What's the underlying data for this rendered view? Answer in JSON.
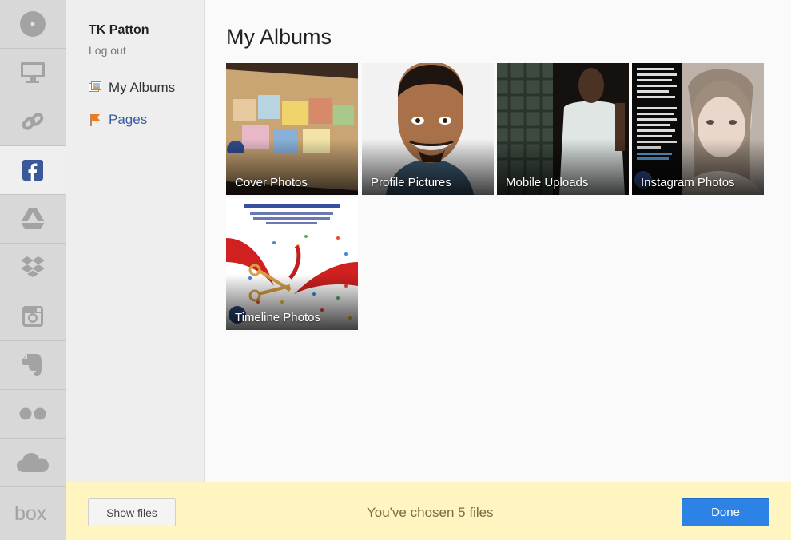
{
  "sidebar": {
    "user_name": "TK Patton",
    "logout_label": "Log out",
    "nav": [
      {
        "label": "My Albums",
        "icon": "photo-album-icon"
      },
      {
        "label": "Pages",
        "icon": "flag-icon"
      }
    ]
  },
  "services": [
    {
      "name": "local-device",
      "icon": "disc-icon"
    },
    {
      "name": "computer",
      "icon": "monitor-icon"
    },
    {
      "name": "link",
      "icon": "link-icon"
    },
    {
      "name": "facebook",
      "icon": "facebook-icon",
      "active": true
    },
    {
      "name": "google-drive",
      "icon": "drive-icon"
    },
    {
      "name": "dropbox",
      "icon": "dropbox-icon"
    },
    {
      "name": "instagram",
      "icon": "instagram-icon"
    },
    {
      "name": "evernote",
      "icon": "evernote-icon"
    },
    {
      "name": "flickr",
      "icon": "flickr-icon"
    },
    {
      "name": "onedrive",
      "icon": "cloud-icon"
    },
    {
      "name": "box",
      "icon": "box-logo",
      "logo_text": "box"
    }
  ],
  "main": {
    "title": "My Albums",
    "albums": [
      {
        "label": "Cover Photos"
      },
      {
        "label": "Profile Pictures"
      },
      {
        "label": "Mobile Uploads"
      },
      {
        "label": "Instagram Photos"
      },
      {
        "label": "Timeline Photos"
      }
    ]
  },
  "footer": {
    "show_files_label": "Show files",
    "status_text": "You've chosen 5 files",
    "done_label": "Done"
  },
  "colors": {
    "accent": "#2d82e6",
    "footer_bg": "#fff5c0",
    "facebook_blue": "#3b5998",
    "link_blue": "#3b5ca0"
  }
}
